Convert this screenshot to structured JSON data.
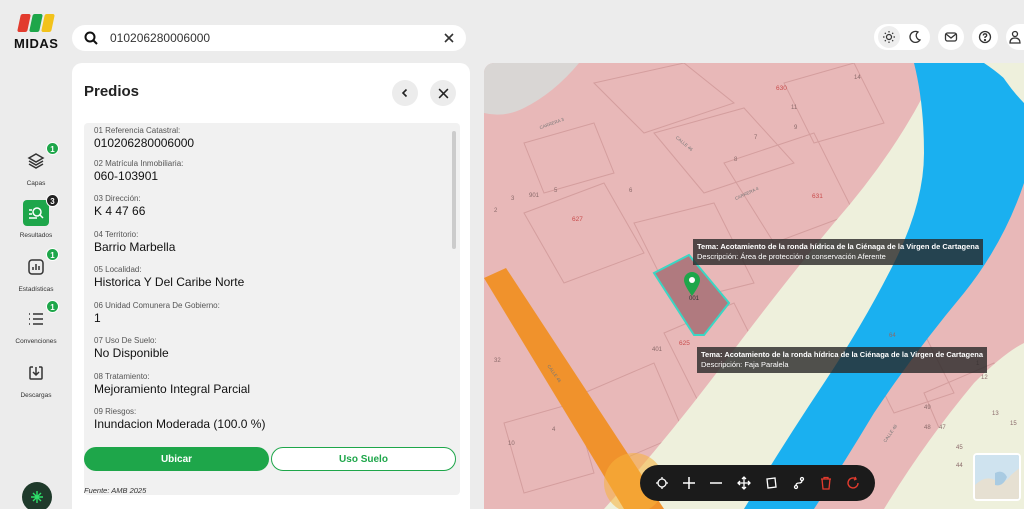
{
  "app": {
    "logo_text": "MIDAS"
  },
  "search": {
    "value": "010206280006000"
  },
  "rail": {
    "items": [
      {
        "label": "Capas",
        "badge": "1"
      },
      {
        "label": "Resultados",
        "badge": "3"
      },
      {
        "label": "Estadísticas",
        "badge": "1"
      },
      {
        "label": "Convenciones",
        "badge": "1"
      },
      {
        "label": "Descargas"
      }
    ]
  },
  "panel": {
    "title": "Predios",
    "fields": [
      {
        "label": "01 Referencia Catastral:",
        "value": "010206280006000"
      },
      {
        "label": "02 Matrícula Inmobiliaria:",
        "value": "060-103901"
      },
      {
        "label": "03 Dirección:",
        "value": "K 4 47 66"
      },
      {
        "label": "04 Territorio:",
        "value": "Barrio Marbella"
      },
      {
        "label": "05 Localidad:",
        "value": "Historica Y Del Caribe Norte"
      },
      {
        "label": "06 Unidad Comunera De Gobierno:",
        "value": "1"
      },
      {
        "label": "07 Uso De Suelo:",
        "value": "No Disponible"
      },
      {
        "label": "08 Tratamiento:",
        "value": "Mejoramiento Integral Parcial"
      },
      {
        "label": "09 Riesgos:",
        "value": "Inundacion Moderada (100.0 %)"
      }
    ],
    "btn_primary": "Ubicar",
    "btn_secondary": "Uso Suelo",
    "source": "Fuente: AMB 2025"
  },
  "map": {
    "tooltips": [
      {
        "title": "Tema: Acotamiento de la ronda hídrica de la Ciénaga de la Virgen de Cartagena",
        "desc": "Descripción: Área de protección o conservación Aferente"
      },
      {
        "title": "Tema: Acotamiento de la ronda hídrica de la Ciénaga de la Virgen de Cartagena",
        "desc": "Descripción: Faja Paralela"
      }
    ],
    "labels": {
      "parcel": "001",
      "block_630": "630",
      "block_631": "631",
      "block_627": "627",
      "block_625": "625",
      "street_1": "CARRERA 3",
      "street_2": "CALLE 46",
      "street_3": "CARRERA 4",
      "street_4": "CALLE 46",
      "street_5": "CALLE 48",
      "n14": "14",
      "n11": "11",
      "n7": "7",
      "n9": "9",
      "n8": "8",
      "n2": "2",
      "n3": "3",
      "n901": "901",
      "n5": "5",
      "n6": "6",
      "n401": "401",
      "n32": "32",
      "n10": "10",
      "n12": "12",
      "n4": "4",
      "n64": "64",
      "n48": "48",
      "n47": "47",
      "n13": "13",
      "n44": "44",
      "n45": "45",
      "n49": "49",
      "n15": "15",
      "n1": "1"
    }
  },
  "colors": {
    "accent": "#1ea64a",
    "zone_pink": "#e8b8b8",
    "water": "#1ab0f0",
    "road": "#f0922c",
    "buffer": "#eef0dc"
  }
}
